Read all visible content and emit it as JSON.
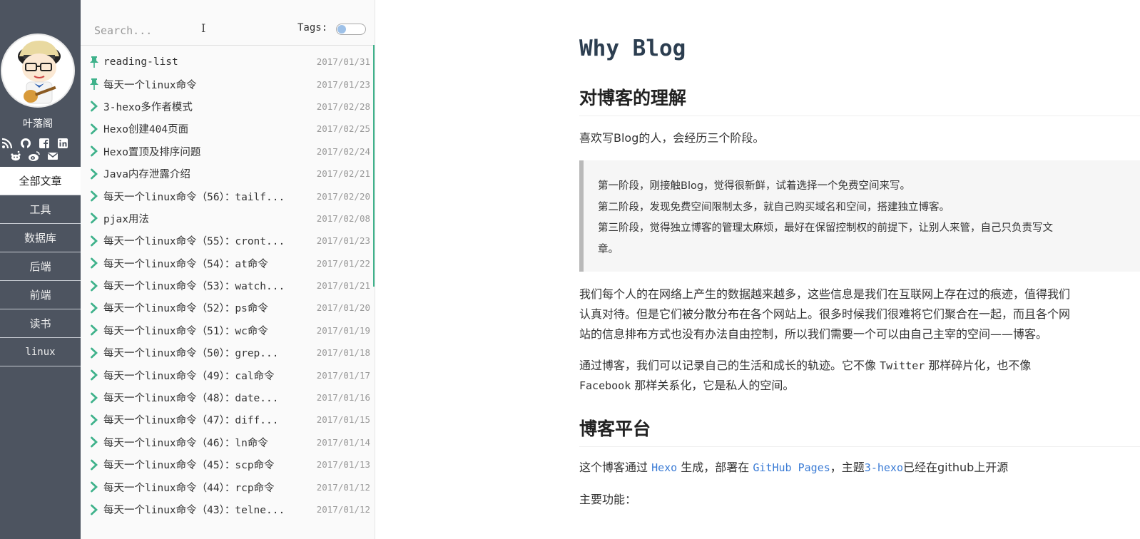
{
  "sidebar": {
    "author": "叶落阁",
    "nav": [
      "全部文章",
      "工具",
      "数据库",
      "后端",
      "前端",
      "读书",
      "linux"
    ]
  },
  "list": {
    "search_placeholder": "Search...",
    "tags_label": "Tags:",
    "posts": [
      {
        "title": "reading-list",
        "date": "2017/01/31",
        "pinned": true
      },
      {
        "title": "每天一个linux命令",
        "date": "2017/01/23",
        "pinned": true
      },
      {
        "title": "3-hexo多作者模式",
        "date": "2017/02/28",
        "pinned": false
      },
      {
        "title": "Hexo创建404页面",
        "date": "2017/02/25",
        "pinned": false
      },
      {
        "title": "Hexo置顶及排序问题",
        "date": "2017/02/24",
        "pinned": false
      },
      {
        "title": "Java内存泄露介绍",
        "date": "2017/02/21",
        "pinned": false
      },
      {
        "title": "每天一个linux命令（56）：tailf...",
        "date": "2017/02/20",
        "pinned": false
      },
      {
        "title": "pjax用法",
        "date": "2017/02/08",
        "pinned": false
      },
      {
        "title": "每天一个linux命令（55）：cront...",
        "date": "2017/01/23",
        "pinned": false
      },
      {
        "title": "每天一个linux命令（54）：at命令",
        "date": "2017/01/22",
        "pinned": false
      },
      {
        "title": "每天一个linux命令（53）：watch...",
        "date": "2017/01/21",
        "pinned": false
      },
      {
        "title": "每天一个linux命令（52）：ps命令",
        "date": "2017/01/20",
        "pinned": false
      },
      {
        "title": "每天一个linux命令（51）：wc命令",
        "date": "2017/01/19",
        "pinned": false
      },
      {
        "title": "每天一个linux命令（50）：grep...",
        "date": "2017/01/18",
        "pinned": false
      },
      {
        "title": "每天一个linux命令（49）：cal命令",
        "date": "2017/01/17",
        "pinned": false
      },
      {
        "title": "每天一个linux命令（48）：date...",
        "date": "2017/01/16",
        "pinned": false
      },
      {
        "title": "每天一个linux命令（47）：diff...",
        "date": "2017/01/15",
        "pinned": false
      },
      {
        "title": "每天一个linux命令（46）：ln命令",
        "date": "2017/01/14",
        "pinned": false
      },
      {
        "title": "每天一个linux命令（45）：scp命令",
        "date": "2017/01/13",
        "pinned": false
      },
      {
        "title": "每天一个linux命令（44）：rcp命令",
        "date": "2017/01/12",
        "pinned": false
      },
      {
        "title": "每天一个linux命令（43）：telne...",
        "date": "2017/01/12",
        "pinned": false
      }
    ]
  },
  "article": {
    "title": "Why Blog",
    "h2_understanding": "对博客的理解",
    "intro": "喜欢写Blog的人，会经历三个阶段。",
    "quote": [
      "第一阶段，刚接触Blog，觉得很新鲜，试着选择一个免费空间来写。",
      "第二阶段，发现免费空间限制太多，就自己购买域名和空间，搭建独立博客。",
      "第三阶段，觉得独立博客的管理太麻烦，最好在保留控制权的前提下，让别人来管，自己只负责写文",
      "章。"
    ],
    "para1": [
      "我们每个人的在网络上产生的数据越来越多，这些信息是我们在互联网上存在过的痕迹，值得我们",
      "认真对待。但是它们被分散分布在各个网站上。很多时候我们很难将它们聚合在一起，而且各个网",
      "站的信息排布方式也没有办法自由控制，所以我们需要一个可以由自己主宰的空间——博客。"
    ],
    "para2_a": "通过博客，我们可以记录自己的生活和成长的轨迹。它不像 ",
    "para2_twitter": "Twitter",
    "para2_b": " 那样碎片化，也不像",
    "para2_facebook": "Facebook",
    "para2_c": " 那样关系化，它是私人的空间。",
    "h2_platform": "博客平台",
    "platform_a": "这个博客通过 ",
    "platform_hexo": "Hexo",
    "platform_b": " 生成，部署在 ",
    "platform_gh": "GitHub Pages",
    "platform_c": "，主题",
    "platform_theme": "3-hexo",
    "platform_d": "已经在github上开源",
    "features_label": "主要功能："
  }
}
